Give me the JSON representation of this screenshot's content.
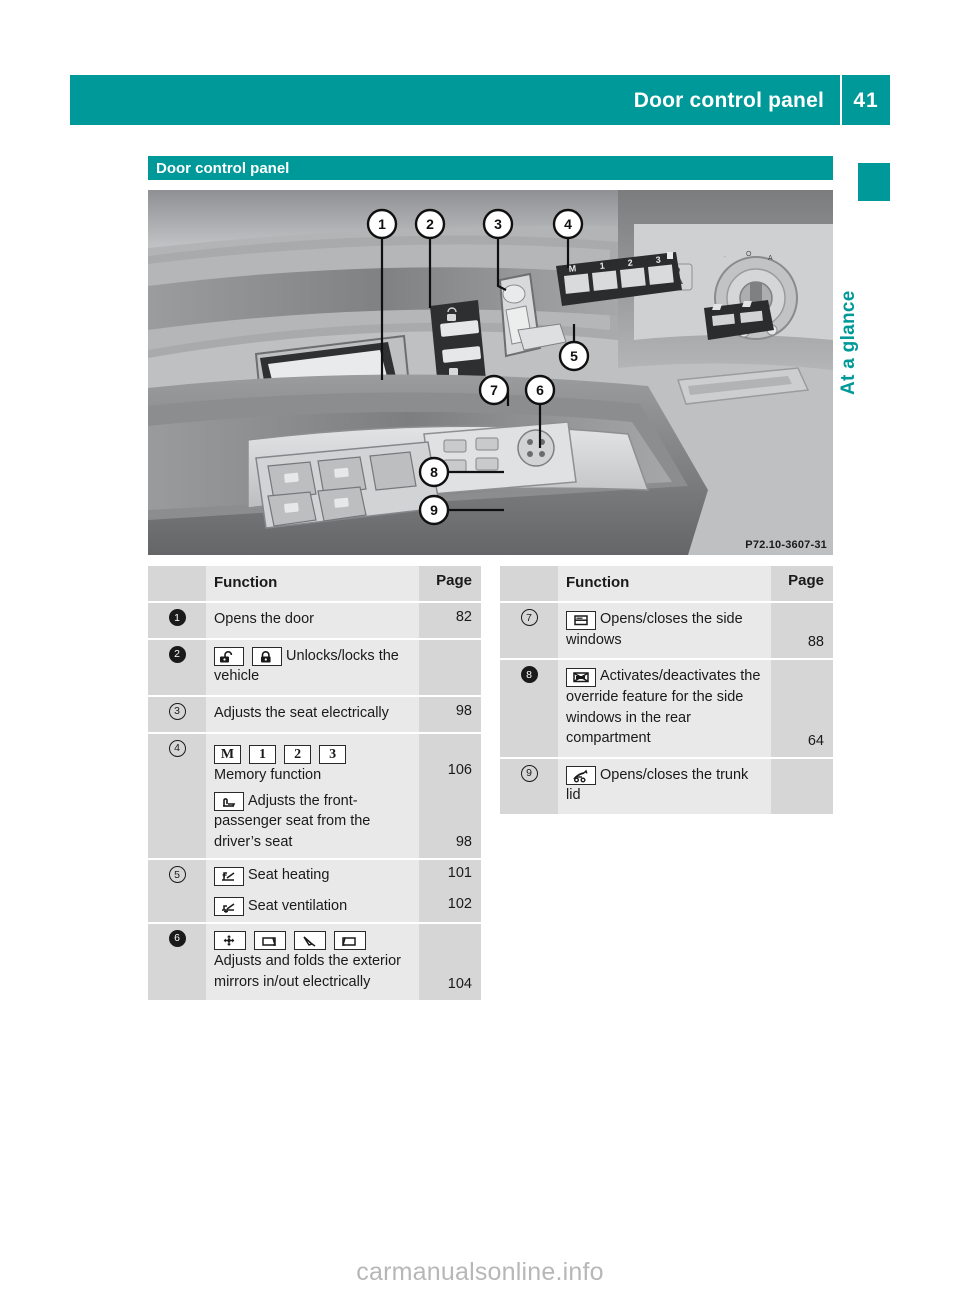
{
  "header": {
    "title": "Door control panel",
    "page_number": "41"
  },
  "side_tab": {
    "label": "At a glance"
  },
  "section": {
    "title": "Door control panel"
  },
  "figure": {
    "caption": "P72.10-3607-31",
    "alt": "Driver's door control panel of a Mercedes-Benz with numbered callouts 1 to 9",
    "callouts": [
      "1",
      "2",
      "3",
      "4",
      "5",
      "6",
      "7",
      "8",
      "9"
    ]
  },
  "tables": {
    "left": {
      "headers": {
        "function": "Function",
        "page": "Page"
      },
      "rows": [
        {
          "num": "1",
          "num_style": "filled",
          "lines": [
            {
              "icons": [],
              "text": "Opens the door"
            }
          ],
          "page": "82"
        },
        {
          "num": "2",
          "num_style": "filled",
          "lines": [
            {
              "icons": [
                "unlock-icon",
                "lock-icon"
              ],
              "text": "Unlocks/locks the vehicle"
            }
          ],
          "page": ""
        },
        {
          "num": "3",
          "num_style": "outline",
          "lines": [
            {
              "icons": [],
              "text": "Adjusts the seat electrically"
            }
          ],
          "page": "98"
        },
        {
          "num": "4",
          "num_style": "outline",
          "lines": [
            {
              "icons": [
                "memory-m-icon",
                "memory-1-icon",
                "memory-2-icon",
                "memory-3-icon"
              ],
              "text": "Memory function",
              "page": "106"
            },
            {
              "icons": [
                "passenger-seat-icon"
              ],
              "text": "Adjusts the front-passenger seat from the driver’s seat",
              "page": "98"
            }
          ],
          "page": ""
        },
        {
          "num": "5",
          "num_style": "outline",
          "lines": [
            {
              "icons": [
                "seat-heating-icon"
              ],
              "text": "Seat heating",
              "page": "101"
            },
            {
              "icons": [
                "seat-ventilation-icon"
              ],
              "text": "Seat ventilation",
              "page": "102"
            }
          ],
          "page": ""
        },
        {
          "num": "6",
          "num_style": "filled",
          "lines": [
            {
              "icons": [
                "mirror-adjust-icon",
                "mirror-left-icon",
                "mirror-fold-icon",
                "mirror-right-icon"
              ],
              "text": "Adjusts and folds the exterior mirrors in/out electrically"
            }
          ],
          "page": "104"
        }
      ]
    },
    "right": {
      "headers": {
        "function": "Function",
        "page": "Page"
      },
      "rows": [
        {
          "num": "7",
          "num_style": "outline",
          "lines": [
            {
              "icons": [
                "side-window-icon"
              ],
              "text": "Opens/closes the side windows"
            }
          ],
          "page": "88"
        },
        {
          "num": "8",
          "num_style": "filled",
          "lines": [
            {
              "icons": [
                "rear-window-override-icon"
              ],
              "text": "Activates/deactivates the override feature for the side windows in the rear compartment"
            }
          ],
          "page": "64"
        },
        {
          "num": "9",
          "num_style": "outline",
          "lines": [
            {
              "icons": [
                "trunk-lid-icon"
              ],
              "text": "Opens/closes the trunk lid"
            }
          ],
          "page": ""
        }
      ]
    }
  },
  "watermark": {
    "text": "carmanualsonline.info"
  },
  "colors": {
    "accent": "#009999",
    "row_label_bg": "#d6d6d6",
    "row_body_bg": "#e9e9e9"
  }
}
